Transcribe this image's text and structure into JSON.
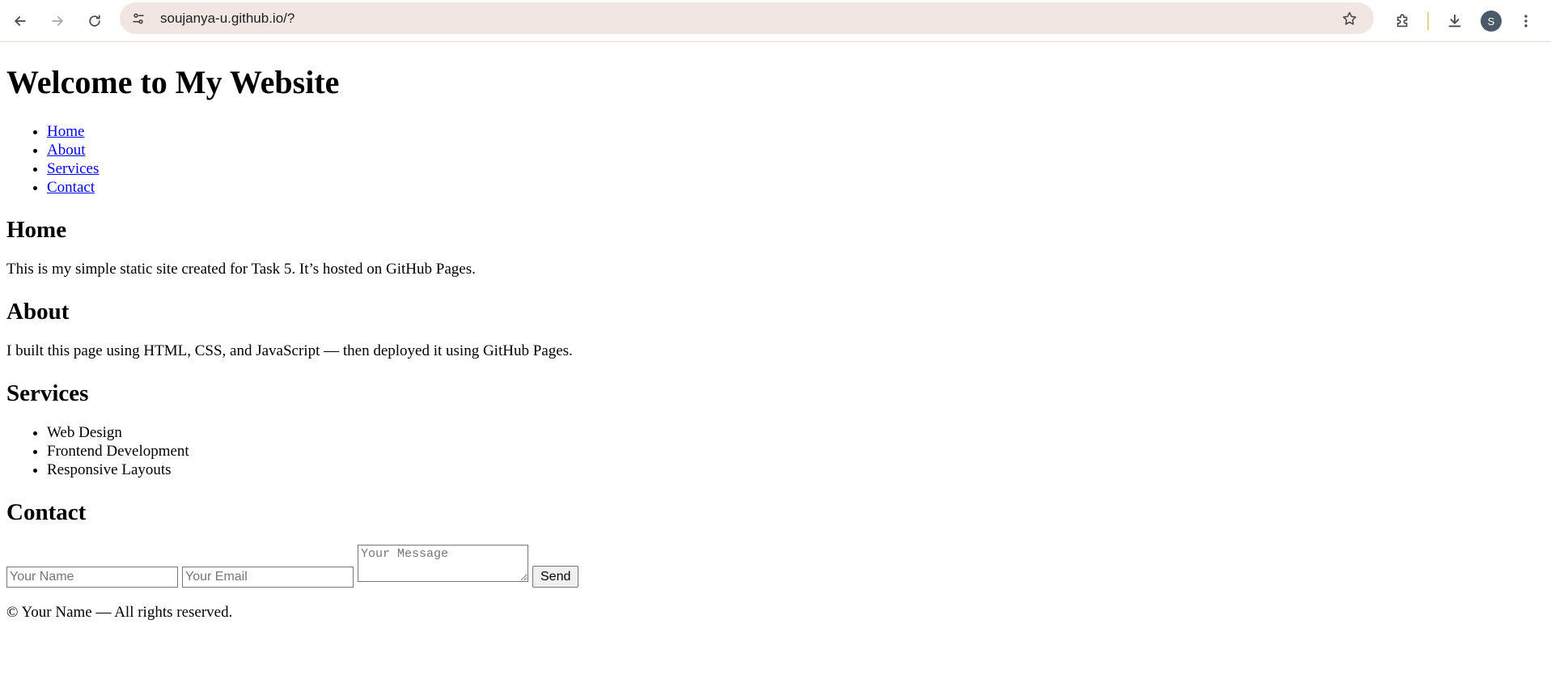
{
  "browser": {
    "url": "soujanya-u.github.io/?",
    "profile_initial": "S",
    "icons": {
      "back": "arrow-left-icon",
      "forward": "arrow-right-icon",
      "reload": "reload-icon",
      "site_info": "tune-icon",
      "bookmark": "star-icon",
      "extensions": "puzzle-icon",
      "downloads": "download-icon",
      "menu": "kebab-menu-icon"
    }
  },
  "page": {
    "title": "Welcome to My Website",
    "nav": [
      "Home",
      "About",
      "Services",
      "Contact"
    ],
    "home": {
      "heading": "Home",
      "text": "This is my simple static site created for Task 5. It’s hosted on GitHub Pages."
    },
    "about": {
      "heading": "About",
      "text": "I built this page using HTML, CSS, and JavaScript — then deployed it using GitHub Pages."
    },
    "services": {
      "heading": "Services",
      "items": [
        "Web Design",
        "Frontend Development",
        "Responsive Layouts"
      ]
    },
    "contact": {
      "heading": "Contact",
      "name_placeholder": "Your Name",
      "email_placeholder": "Your Email",
      "message_placeholder": "Your Message",
      "send_label": "Send"
    },
    "footer": "© Your Name — All rights reserved."
  }
}
